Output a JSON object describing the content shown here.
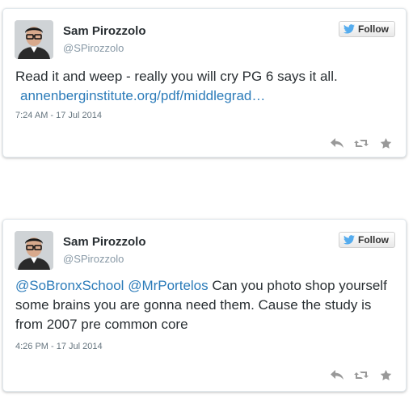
{
  "tweets": [
    {
      "author": {
        "name": "Sam Pirozzolo",
        "handle": "@SPirozzolo"
      },
      "follow_label": "Follow",
      "text": "Read it and weep - really you will cry PG 6 says it all.",
      "link": "annenberginstitute.org/pdf/middlegrad…",
      "timestamp": "7:24 AM - 17 Jul 2014",
      "actions": [
        "reply-icon",
        "retweet-icon",
        "favorite-icon"
      ]
    },
    {
      "author": {
        "name": "Sam Pirozzolo",
        "handle": "@SPirozzolo"
      },
      "follow_label": "Follow",
      "mentions": [
        "@SoBronxSchool",
        "@MrPortelos"
      ],
      "text": "Can you photo shop yourself some brains you are gonna need them. Cause the study is from 2007 pre common core",
      "timestamp": "4:26 PM - 17 Jul 2014",
      "actions": [
        "reply-icon",
        "retweet-icon",
        "favorite-icon"
      ]
    }
  ],
  "colors": {
    "link": "#2b7bb9",
    "twitter_bird": "#55acee",
    "action_icon": "#999999"
  }
}
